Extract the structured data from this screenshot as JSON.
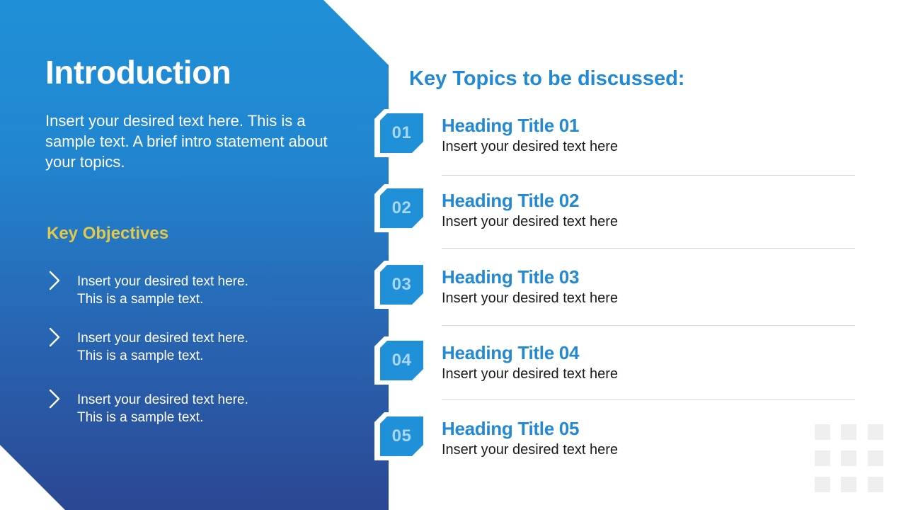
{
  "slide": {
    "colors": {
      "panel_top": "#1f90d7",
      "panel_bottom": "#2b4793",
      "accent_blue": "#2389d3",
      "badge_fill": "#2090d8",
      "badge_text": "#a9d6f5",
      "objectives_heading": "#e2c94a",
      "divider": "#d6d6d6",
      "deco_square": "#efefef"
    },
    "left": {
      "title": "Introduction",
      "intro_text": "Insert your desired text here. This is a sample text. A brief intro statement about your topics.",
      "objectives_heading": "Key Objectives",
      "objectives": [
        {
          "icon": "chevron-right-icon",
          "line1": "Insert your desired text here.",
          "line2": "This is a sample text."
        },
        {
          "icon": "chevron-right-icon",
          "line1": "Insert your desired text here.",
          "line2": "This is a sample text."
        },
        {
          "icon": "chevron-right-icon",
          "line1": "Insert your desired text here.",
          "line2": "This is a sample text."
        }
      ]
    },
    "right": {
      "title": "Key Topics to be discussed:",
      "topics": [
        {
          "number": "01",
          "heading": "Heading Title 01",
          "text": "Insert your desired text here"
        },
        {
          "number": "02",
          "heading": "Heading Title 02",
          "text": "Insert your desired text here"
        },
        {
          "number": "03",
          "heading": "Heading Title 03",
          "text": "Insert your desired text here"
        },
        {
          "number": "04",
          "heading": "Heading Title 04",
          "text": "Insert your desired text here"
        },
        {
          "number": "05",
          "heading": "Heading Title 05",
          "text": "Insert your desired text here"
        }
      ]
    },
    "decoration": {
      "icon": "dot-grid-icon",
      "rows": 3,
      "cols": 3
    }
  }
}
